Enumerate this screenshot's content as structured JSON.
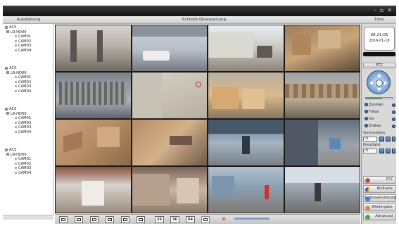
{
  "header": {
    "left_label": "Ausstattung",
    "center_label": "Echtzeit-Überwachung",
    "right_label": "Time"
  },
  "window_controls": [
    "–",
    "▫",
    "✕"
  ],
  "tree": {
    "groups": [
      {
        "root": "ACS",
        "device": "LR-HD06",
        "cameras": [
          "CAM01",
          "CAM02",
          "CAM03",
          "CAM04"
        ]
      },
      {
        "root": "ACS",
        "device": "LR-HD06",
        "cameras": [
          "CAM01",
          "CAM02",
          "CAM03",
          "CAM04"
        ]
      },
      {
        "root": "ACS",
        "device": "LR-HD06",
        "cameras": [
          "CAM01",
          "CAM02",
          "CAM03",
          "CAM04"
        ]
      },
      {
        "root": "ACS",
        "device": "LR-HD06",
        "cameras": [
          "CAM01",
          "CAM02",
          "CAM03",
          "CAM04"
        ]
      }
    ]
  },
  "layout_buttons": [
    "",
    "",
    "",
    "",
    "",
    "",
    "25",
    "36",
    "64"
  ],
  "clock": {
    "time": "08:21:06",
    "date": "2016-01-18"
  },
  "ptz": {
    "title": "PTZ",
    "speed_fraction": 0.6,
    "controls": [
      "Zoomen",
      "Fokus",
      "Iris",
      "Drehen"
    ],
    "preset_label": "Voreinstellun",
    "preset_value": "01",
    "cruise_label": "Kreuzfahrt",
    "cruise_value": "01"
  },
  "menu": [
    "PTZ",
    "Bildfarbe",
    "Systemeinstellung",
    "Wiedergabe",
    "Advanced"
  ],
  "colors": {
    "ptz_ring": "#7da6d8",
    "volume": "#7fa0d0",
    "titlebar": "#222222"
  }
}
